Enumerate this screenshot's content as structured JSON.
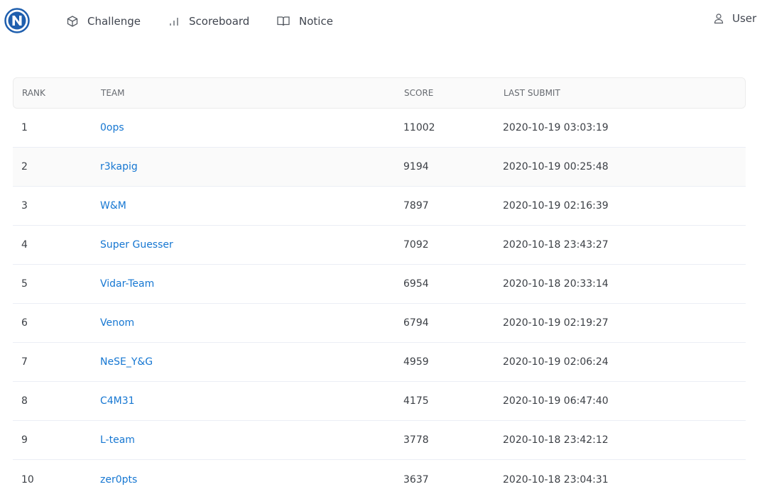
{
  "nav": {
    "logo_icon": "n-logo-icon",
    "items": [
      {
        "label": "Challenge",
        "icon": "cube-icon"
      },
      {
        "label": "Scoreboard",
        "icon": "bar-chart-icon"
      },
      {
        "label": "Notice",
        "icon": "book-icon"
      }
    ],
    "user": {
      "label": "User",
      "icon": "user-icon"
    }
  },
  "table": {
    "headers": {
      "rank": "RANK",
      "team": "TEAM",
      "score": "SCORE",
      "last_submit": "LAST SUBMIT"
    },
    "rows": [
      {
        "rank": "1",
        "team": "0ops",
        "score": "11002",
        "last_submit": "2020-10-19 03:03:19"
      },
      {
        "rank": "2",
        "team": "r3kapig",
        "score": "9194",
        "last_submit": "2020-10-19 00:25:48"
      },
      {
        "rank": "3",
        "team": "W&M",
        "score": "7897",
        "last_submit": "2020-10-19 02:16:39"
      },
      {
        "rank": "4",
        "team": "Super Guesser",
        "score": "7092",
        "last_submit": "2020-10-18 23:43:27"
      },
      {
        "rank": "5",
        "team": "Vidar-Team",
        "score": "6954",
        "last_submit": "2020-10-18 20:33:14"
      },
      {
        "rank": "6",
        "team": "Venom",
        "score": "6794",
        "last_submit": "2020-10-19 02:19:27"
      },
      {
        "rank": "7",
        "team": "NeSE_Y&G",
        "score": "4959",
        "last_submit": "2020-10-19 02:06:24"
      },
      {
        "rank": "8",
        "team": "C4M31",
        "score": "4175",
        "last_submit": "2020-10-19 06:47:40"
      },
      {
        "rank": "9",
        "team": "L-team",
        "score": "3778",
        "last_submit": "2020-10-18 23:42:12"
      },
      {
        "rank": "10",
        "team": "zer0pts",
        "score": "3637",
        "last_submit": "2020-10-18 23:04:31"
      }
    ]
  },
  "colors": {
    "link": "#1677d2",
    "logo": "#1f5fae",
    "header_bg": "#fafafa"
  }
}
